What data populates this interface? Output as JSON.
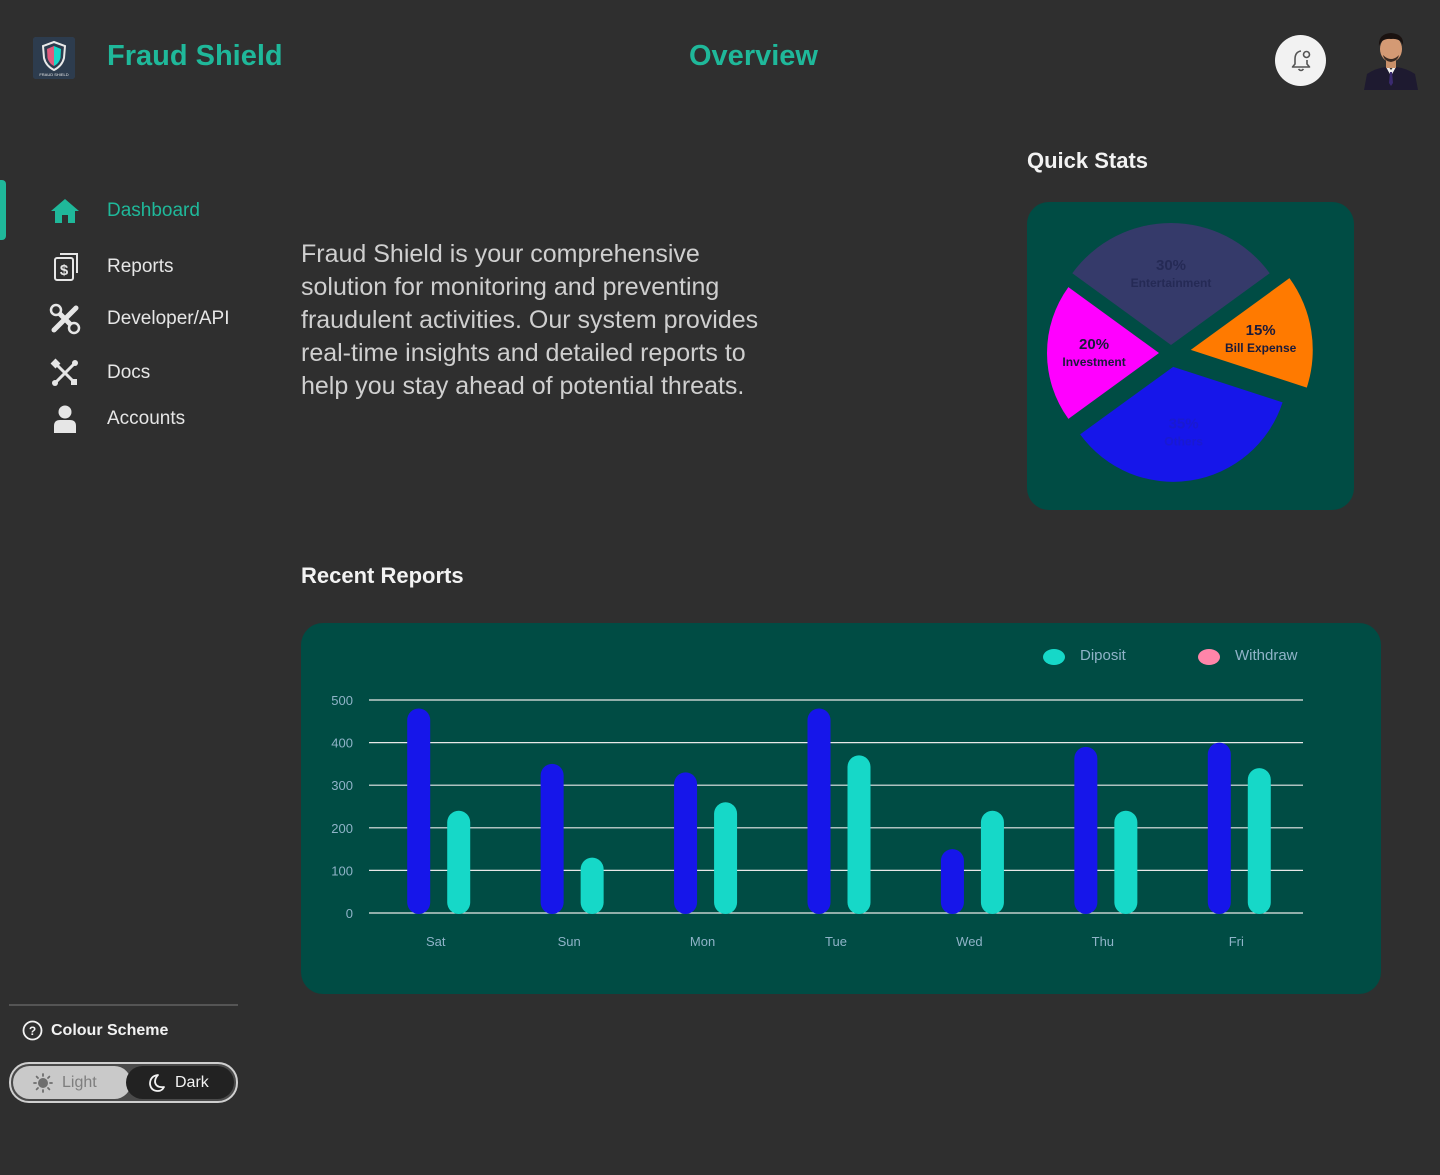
{
  "header": {
    "app_title": "Fraud Shield",
    "logo_text": "FRAUD SHIELD",
    "page_title": "Overview"
  },
  "sidebar": {
    "items": [
      {
        "label": "Dashboard",
        "icon": "home-icon",
        "active": true
      },
      {
        "label": "Reports",
        "icon": "reports-icon",
        "active": false
      },
      {
        "label": "Developer/API",
        "icon": "tools-icon",
        "active": false
      },
      {
        "label": "Docs",
        "icon": "docs-icon",
        "active": false
      },
      {
        "label": "Accounts",
        "icon": "user-icon",
        "active": false
      }
    ],
    "colour_scheme_label": "Colour Scheme",
    "theme_light_label": "Light",
    "theme_dark_label": "Dark",
    "selected_theme": "Dark"
  },
  "intro_text": "Fraud Shield is your comprehensive solution for monitoring and preventing fraudulent activities. Our system provides real-time insights and detailed reports to help you stay ahead of potential threats.",
  "quick_stats": {
    "title": "Quick Stats"
  },
  "recent_reports": {
    "title": "Recent Reports"
  },
  "colors": {
    "accent": "#1fb89a",
    "card": "#004c44",
    "background": "#2f2f2f"
  },
  "chart_data": [
    {
      "type": "pie",
      "slices": [
        {
          "label": "Entertainment",
          "pct": "30%",
          "value": 30,
          "color": "#353a6a",
          "text_color": "#252a55"
        },
        {
          "label": "Bill Expense",
          "pct": "15%",
          "value": 15,
          "color": "#ff7a00",
          "text_color": "#1a1a3a"
        },
        {
          "label": "Others",
          "pct": "35%",
          "value": 35,
          "color": "#1616ea",
          "text_color": "#1a1ad0"
        },
        {
          "label": "Investment",
          "pct": "20%",
          "value": 20,
          "color": "#ff00ff",
          "text_color": "#1a1a3a"
        }
      ]
    },
    {
      "type": "bar",
      "categories": [
        "Sat",
        "Sun",
        "Mon",
        "Tue",
        "Wed",
        "Thu",
        "Fri"
      ],
      "series": [
        {
          "name": "Diposit",
          "values": [
            480,
            350,
            330,
            480,
            150,
            390,
            400
          ],
          "color": "#1616ea"
        },
        {
          "name": "Withdraw",
          "values": [
            240,
            130,
            260,
            370,
            240,
            240,
            340
          ],
          "color": "#16d8c8"
        }
      ],
      "legend": [
        {
          "name": "Diposit",
          "color": "#16d8c8"
        },
        {
          "name": "Withdraw",
          "color": "#ff85a9"
        }
      ],
      "yticks": [
        "0",
        "100",
        "200",
        "300",
        "400",
        "500"
      ],
      "ylim": [
        0,
        500
      ],
      "grid": true,
      "legend_position": "top-right"
    }
  ]
}
